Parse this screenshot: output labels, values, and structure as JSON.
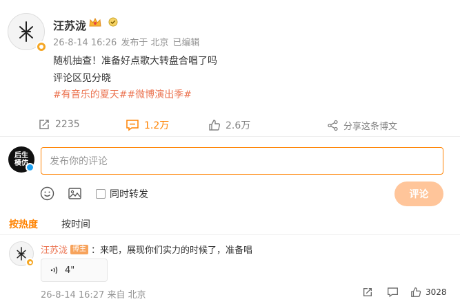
{
  "post": {
    "username": "汪苏泷",
    "timestamp": "26-8-14 16:26",
    "source": "发布于 北京",
    "edited": "已编辑",
    "line1": "随机抽查！准备好点歌大转盘合唱了吗",
    "line2": "评论区见分晓",
    "hashtags": "#有音乐的夏天##微博演出季#",
    "reposts": "2235",
    "comments": "1.2万",
    "likes": "2.6万",
    "share": "分享这条博文"
  },
  "composer": {
    "placeholder": "发布你的评论",
    "repost_toggle": "同时转发",
    "submit": "评论",
    "avatar_text_top": "后生",
    "avatar_text_bottom": "模仿"
  },
  "sort": {
    "hot": "按热度",
    "time": "按时间"
  },
  "comment": {
    "name": "汪苏泷",
    "badge": "博主",
    "text": "：来吧，展现你们实力的时候了，准备唱",
    "voice_duration": "4\"",
    "timestamp": "26-8-14 16:27 来自 北京",
    "likes": "3028"
  },
  "colors": {
    "accent": "#ff8200",
    "link": "#eb7350",
    "submit_disabled": "#ffc59a"
  },
  "icons": [
    "repost-icon",
    "comment-icon",
    "like-icon",
    "share-icon",
    "emoji-icon",
    "image-icon",
    "voice-icon",
    "crown-icon",
    "fan-badge-icon"
  ]
}
